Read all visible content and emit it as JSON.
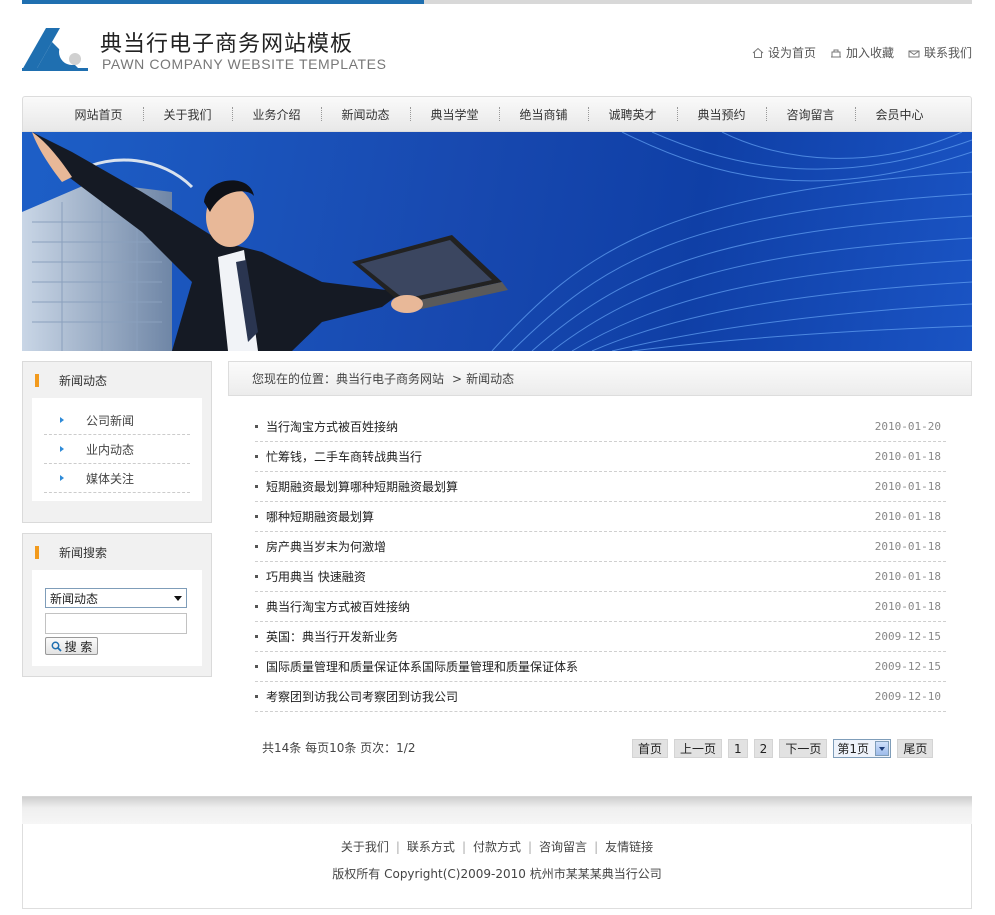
{
  "header": {
    "logo_cn": "典当行电子商务网站模板",
    "logo_en": "PAWN COMPANY WEBSITE TEMPLATES",
    "quick_links": [
      {
        "label": "设为首页",
        "icon": "home-icon"
      },
      {
        "label": "加入收藏",
        "icon": "favorite-icon"
      },
      {
        "label": "联系我们",
        "icon": "contact-icon"
      }
    ]
  },
  "nav": {
    "items": [
      "网站首页",
      "关于我们",
      "业务介绍",
      "新闻动态",
      "典当学堂",
      "绝当商铺",
      "诚聘英才",
      "典当预约",
      "咨询留言",
      "会员中心"
    ]
  },
  "sidebar": {
    "news_box": {
      "title": "新闻动态",
      "items": [
        "公司新闻",
        "业内动态",
        "媒体关注"
      ]
    },
    "search_box": {
      "title": "新闻搜索",
      "select_value": "新闻动态",
      "input_value": "",
      "button_label": "搜 索"
    }
  },
  "breadcrumb": {
    "prefix": "您现在的位置：典当行电子商务网站",
    "sep": ">",
    "current": "新闻动态"
  },
  "news": [
    {
      "title": "当行淘宝方式被百姓接纳",
      "date": "2010-01-20"
    },
    {
      "title": "忙筹钱，二手车商转战典当行",
      "date": "2010-01-18"
    },
    {
      "title": "短期融资最划算哪种短期融资最划算",
      "date": "2010-01-18"
    },
    {
      "title": "哪种短期融资最划算",
      "date": "2010-01-18"
    },
    {
      "title": "房产典当岁末为何激增",
      "date": "2010-01-18"
    },
    {
      "title": "巧用典当 快速融资",
      "date": "2010-01-18"
    },
    {
      "title": "典当行淘宝方式被百姓接纳",
      "date": "2010-01-18"
    },
    {
      "title": "英国：典当行开发新业务",
      "date": "2009-12-15"
    },
    {
      "title": "国际质量管理和质量保证体系国际质量管理和质量保证体系",
      "date": "2009-12-15"
    },
    {
      "title": "考察团到访我公司考察团到访我公司",
      "date": "2009-12-10"
    }
  ],
  "pagination": {
    "info": "共14条 每页10条 页次：1/2",
    "first": "首页",
    "prev": "上一页",
    "pages": [
      "1",
      "2"
    ],
    "next": "下一页",
    "select_value": "第1页",
    "last": "尾页"
  },
  "footer": {
    "links": [
      "关于我们",
      "联系方式",
      "付款方式",
      "咨询留言",
      "友情链接"
    ],
    "separator": "|",
    "copyright": "版权所有 Copyright(C)2009-2010 杭州市某某某典当行公司"
  },
  "colors": {
    "accent_blue": "#1f6fb0",
    "sidebar_marker": "#f29a1d",
    "banner_blue": "#1849b0"
  }
}
